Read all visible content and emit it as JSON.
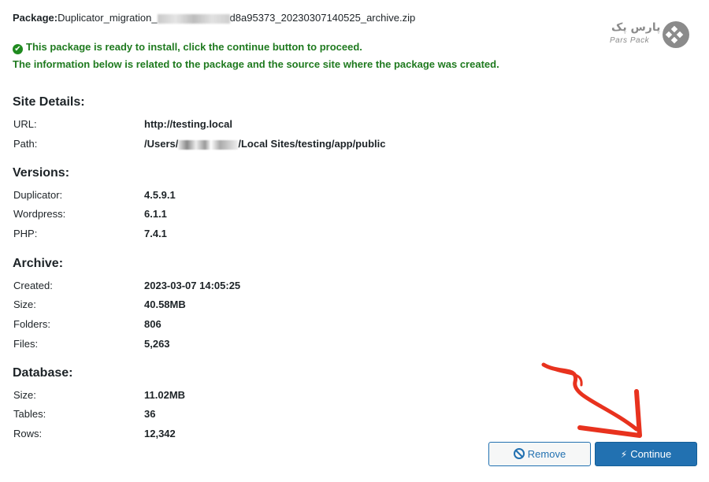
{
  "package": {
    "label": "Package:",
    "name_start": "Duplicator_migration_",
    "name_end": "d8a95373_20230307140525_archive.zip"
  },
  "messages": {
    "ready": "This package is ready to install, click the continue button to proceed.",
    "info": "The information below is related to the package and the source site where the package was created."
  },
  "site_details": {
    "title": "Site Details:",
    "url_label": "URL:",
    "url_value": "http://testing.local",
    "path_label": "Path:",
    "path_start": "/Users/",
    "path_end": "/Local Sites/testing/app/public"
  },
  "versions": {
    "title": "Versions:",
    "rows": [
      {
        "label": "Duplicator:",
        "value": "4.5.9.1"
      },
      {
        "label": "Wordpress:",
        "value": "6.1.1"
      },
      {
        "label": "PHP:",
        "value": "7.4.1"
      }
    ]
  },
  "archive": {
    "title": "Archive:",
    "rows": [
      {
        "label": "Created:",
        "value": "2023-03-07 14:05:25"
      },
      {
        "label": "Size:",
        "value": "40.58MB"
      },
      {
        "label": "Folders:",
        "value": "806"
      },
      {
        "label": "Files:",
        "value": "5,263"
      }
    ]
  },
  "database": {
    "title": "Database:",
    "rows": [
      {
        "label": "Size:",
        "value": "11.02MB"
      },
      {
        "label": "Tables:",
        "value": "36"
      },
      {
        "label": "Rows:",
        "value": "12,342"
      }
    ]
  },
  "buttons": {
    "remove": "Remove",
    "continue": "Continue"
  },
  "logo": {
    "text_fa": "پارس پک",
    "text_en": "Pars Pack"
  },
  "colors": {
    "success": "#1f7a1f",
    "primary": "#2271b1",
    "annotation": "#e8321e"
  },
  "icons": {
    "ready": "check-circle-icon",
    "remove": "ban-icon",
    "continue": "bolt-icon",
    "annotation": "red-arrow-icon"
  }
}
